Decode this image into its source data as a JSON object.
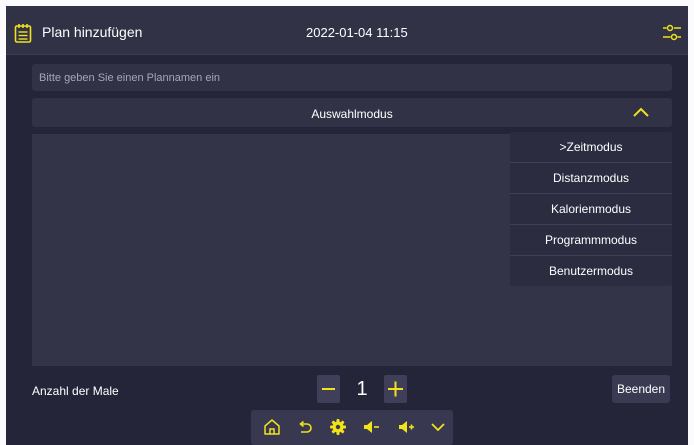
{
  "header": {
    "title": "Plan hinzufügen",
    "datetime": "2022-01-04 11:15",
    "left_icon": "notepad-icon",
    "right_icon": "sliders-icon"
  },
  "plan_name": {
    "value": "",
    "placeholder": "Bitte geben Sie einen Plannamen ein"
  },
  "mode_select": {
    "label": "Auswahlmodus",
    "expanded": true,
    "icon": "chevron-up-icon"
  },
  "mode_options": [
    ">Zeitmodus",
    "Distanzmodus",
    "Kalorienmodus",
    "Programmmodus",
    "Benutzermodus"
  ],
  "repeat": {
    "label": "Anzahl der Male",
    "value": "1"
  },
  "end_button": "Beenden",
  "nav_icons": [
    "home-icon",
    "back-icon",
    "gear-icon",
    "volume-down-icon",
    "volume-up-icon",
    "chevron-down-icon"
  ],
  "colors": {
    "accent": "#f2e21a",
    "background": "#25253a",
    "panel": "#323247"
  }
}
